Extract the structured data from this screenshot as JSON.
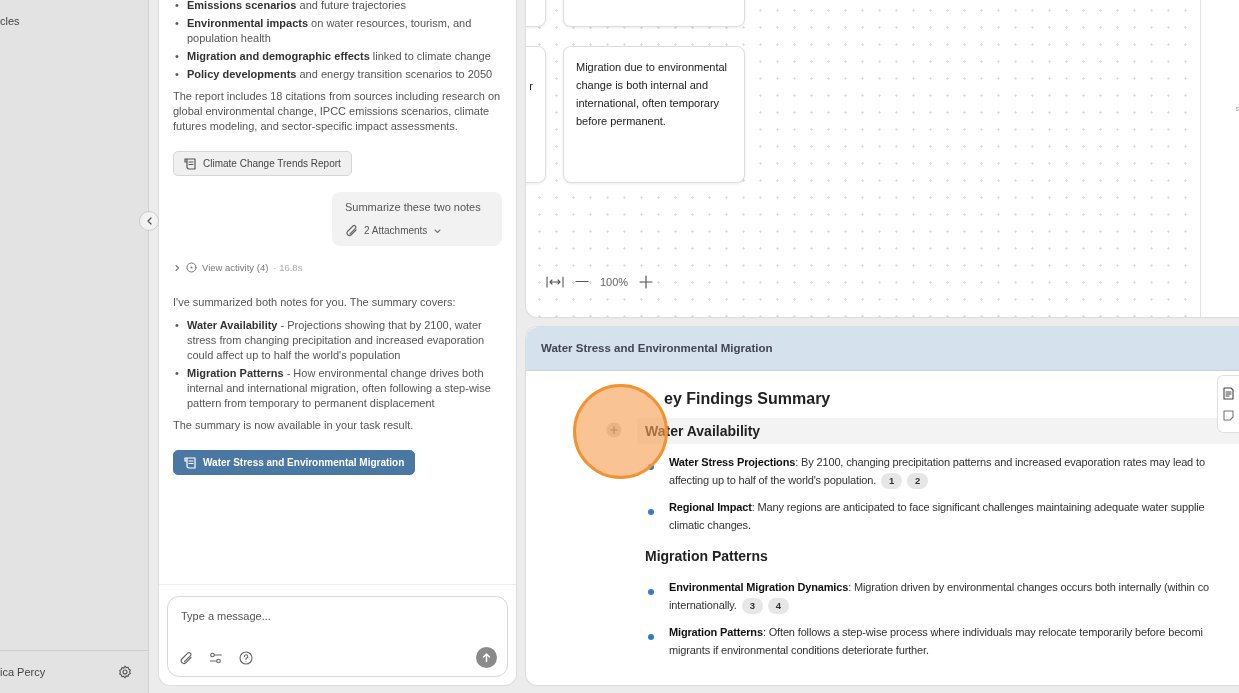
{
  "sidebar": {
    "items": [
      {
        "label": "cles"
      }
    ],
    "user": {
      "name": "ica Percy"
    }
  },
  "chat": {
    "blocks": [
      {
        "kind": "list",
        "marker": "•",
        "items": [
          "**Emissions scenarios** and future trajectories",
          "**Environmental impacts** on water resources, tourism, and population health",
          "**Migration and demographic effects** linked to climate change",
          "**Policy developments** and energy transition scenarios to 2050"
        ]
      },
      {
        "kind": "paragraph",
        "text": "The report includes 18 citations from sources including research on global environmental change, IPCC emissions scenarios, climate futures modeling, and sector-specific impact assessments."
      },
      {
        "kind": "document",
        "label": "Climate Change Trends Report",
        "highlighted": false
      },
      {
        "kind": "user",
        "text": "Summarize these two notes",
        "attachments": "2 Attachments"
      },
      {
        "kind": "activity",
        "label": "View activity (4)",
        "duration": "· 16.8s",
        "expanded": false
      },
      {
        "kind": "paragraph",
        "text": "I've summarized both notes for you. The summary covers:"
      },
      {
        "kind": "list",
        "marker": "•",
        "items": [
          "**Water Availability** - Projections showing that by 2100, water stress from changing precipitation and increased evaporation could affect up to half the world's population",
          "**Migration Patterns** - How environmental change drives both internal and international migration, often following a step-wise pattern from temporary to permanent displacement"
        ]
      },
      {
        "kind": "paragraph",
        "text": "The summary is now available in your task result."
      },
      {
        "kind": "document",
        "label": "Water Stress and Environmental Migration",
        "highlighted": true
      }
    ],
    "input": {
      "placeholder": "Type a message..."
    }
  },
  "canvas": {
    "cards": [
      {
        "text": "r"
      },
      {
        "text": "Migration due to environmental change is both internal and international, often temporary before permanent."
      }
    ],
    "zoom": "100%",
    "side_text": "s"
  },
  "document": {
    "title": "Water Stress and Environmental Migration",
    "heading": "ey Findings Summary",
    "sections": [
      {
        "heading": "Water Availability",
        "highlighted": true,
        "items": [
          {
            "lines": [
              "**Water Stress Projections**: By 2100, changing precipitation patterns and increased evaporation rates may lead to",
              "affecting up to half of the world's population."
            ],
            "citations": [
              "1",
              "2"
            ]
          },
          {
            "lines": [
              "**Regional Impact**: Many regions are anticipated to face significant challenges maintaining adequate water supplie",
              "climatic changes."
            ]
          }
        ]
      },
      {
        "heading": "Migration Patterns",
        "highlighted": false,
        "items": [
          {
            "lines": [
              "**Environmental Migration Dynamics**: Migration driven by environmental changes occurs both internally (within co",
              "internationally."
            ],
            "citations": [
              "3",
              "4"
            ]
          },
          {
            "lines": [
              "**Migration Patterns**: Often follows a step-wise process where individuals may relocate temporarily before becomi",
              "migrants if environmental conditions deteriorate further."
            ]
          }
        ]
      }
    ]
  }
}
